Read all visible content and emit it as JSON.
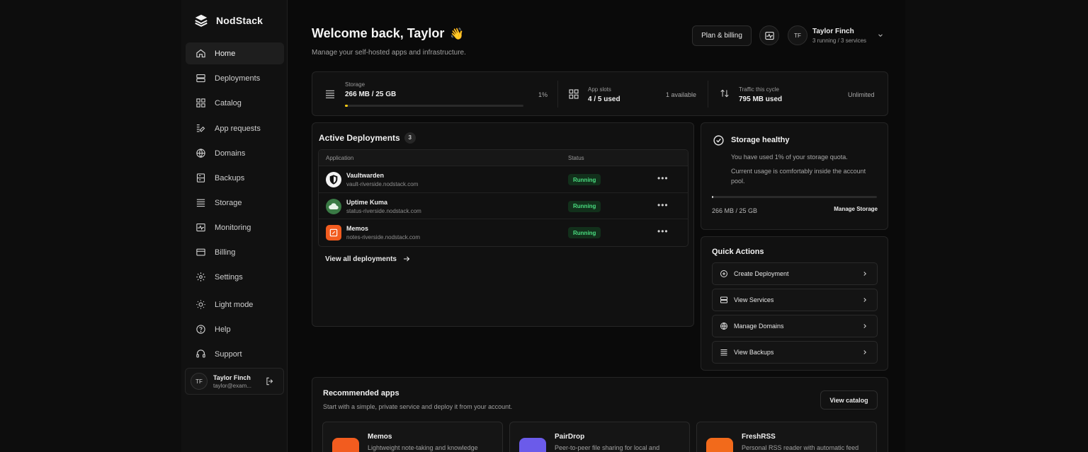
{
  "brand": {
    "name": "NodStack"
  },
  "sidebar": {
    "items": [
      {
        "label": "Home",
        "icon": "home-icon"
      },
      {
        "label": "Deployments",
        "icon": "server-icon"
      },
      {
        "label": "Catalog",
        "icon": "grid-icon"
      },
      {
        "label": "App requests",
        "icon": "request-icon"
      },
      {
        "label": "Domains",
        "icon": "globe-icon"
      },
      {
        "label": "Backups",
        "icon": "backup-icon"
      },
      {
        "label": "Storage",
        "icon": "storage-icon"
      },
      {
        "label": "Monitoring",
        "icon": "monitor-icon"
      },
      {
        "label": "Billing",
        "icon": "card-icon"
      },
      {
        "label": "Settings",
        "icon": "gear-icon"
      },
      {
        "label": "Light mode",
        "icon": "sun-icon"
      },
      {
        "label": "Help",
        "icon": "help-icon"
      },
      {
        "label": "Support",
        "icon": "support-icon"
      }
    ],
    "user": {
      "initials": "TF",
      "name": "Taylor Finch",
      "email": "taylor@exam..."
    }
  },
  "header": {
    "welcome": "Welcome back, Taylor",
    "emoji": "👋",
    "subtitle": "Manage your self-hosted apps and infrastructure.",
    "plan_button": "Plan & billing",
    "user": {
      "initials": "TF",
      "name": "Taylor Finch",
      "summary": "3 running / 3 services"
    }
  },
  "stats": {
    "storage": {
      "label": "Storage",
      "value": "266 MB / 25 GB",
      "percent_text": "1%",
      "percent": 0.01
    },
    "slots": {
      "label": "App slots",
      "value": "4 / 5 used",
      "side": "1 available"
    },
    "traffic": {
      "label": "Traffic this cycle",
      "value": "795 MB used",
      "side": "Unlimited"
    }
  },
  "deployments": {
    "title": "Active Deployments",
    "count": "3",
    "columns": {
      "application": "Application",
      "status": "Status"
    },
    "rows": [
      {
        "name": "Vaultwarden",
        "url": "vault-riverside.nodstack.com",
        "status": "Running",
        "icon": "shield-icon"
      },
      {
        "name": "Uptime Kuma",
        "url": "status-riverside.nodstack.com",
        "status": "Running",
        "icon": "cloud-icon"
      },
      {
        "name": "Memos",
        "url": "notes-riverside.nodstack.com",
        "status": "Running",
        "icon": "note-icon"
      }
    ],
    "row_menu": "•••",
    "view_all": "View all deployments"
  },
  "storage_health": {
    "title": "Storage healthy",
    "line1": "You have used 1% of your storage quota.",
    "line2": "Current usage is comfortably inside the account pool.",
    "usage": "266 MB / 25 GB",
    "usage_fraction": 0.01,
    "manage": "Manage Storage"
  },
  "quick_actions": {
    "title": "Quick Actions",
    "items": [
      {
        "label": "Create Deployment",
        "icon": "plus-circle-icon"
      },
      {
        "label": "View Services",
        "icon": "server-icon"
      },
      {
        "label": "Manage Domains",
        "icon": "globe-icon"
      },
      {
        "label": "View Backups",
        "icon": "list-icon"
      }
    ]
  },
  "recommended": {
    "title": "Recommended apps",
    "subtitle": "Start with a simple, private service and deploy it from your account.",
    "view_catalog": "View catalog",
    "apps": [
      {
        "name": "Memos",
        "desc": "Lightweight note-taking and knowledge",
        "color": "#f25c1f"
      },
      {
        "name": "PairDrop",
        "desc": "Peer-to-peer file sharing for local and",
        "color": "#6b5bea"
      },
      {
        "name": "FreshRSS",
        "desc": "Personal RSS reader with automatic feed",
        "color": "#f26a1b"
      }
    ]
  },
  "colors": {
    "accent_running": "#4ade80",
    "storage_bar": "#facc15"
  }
}
